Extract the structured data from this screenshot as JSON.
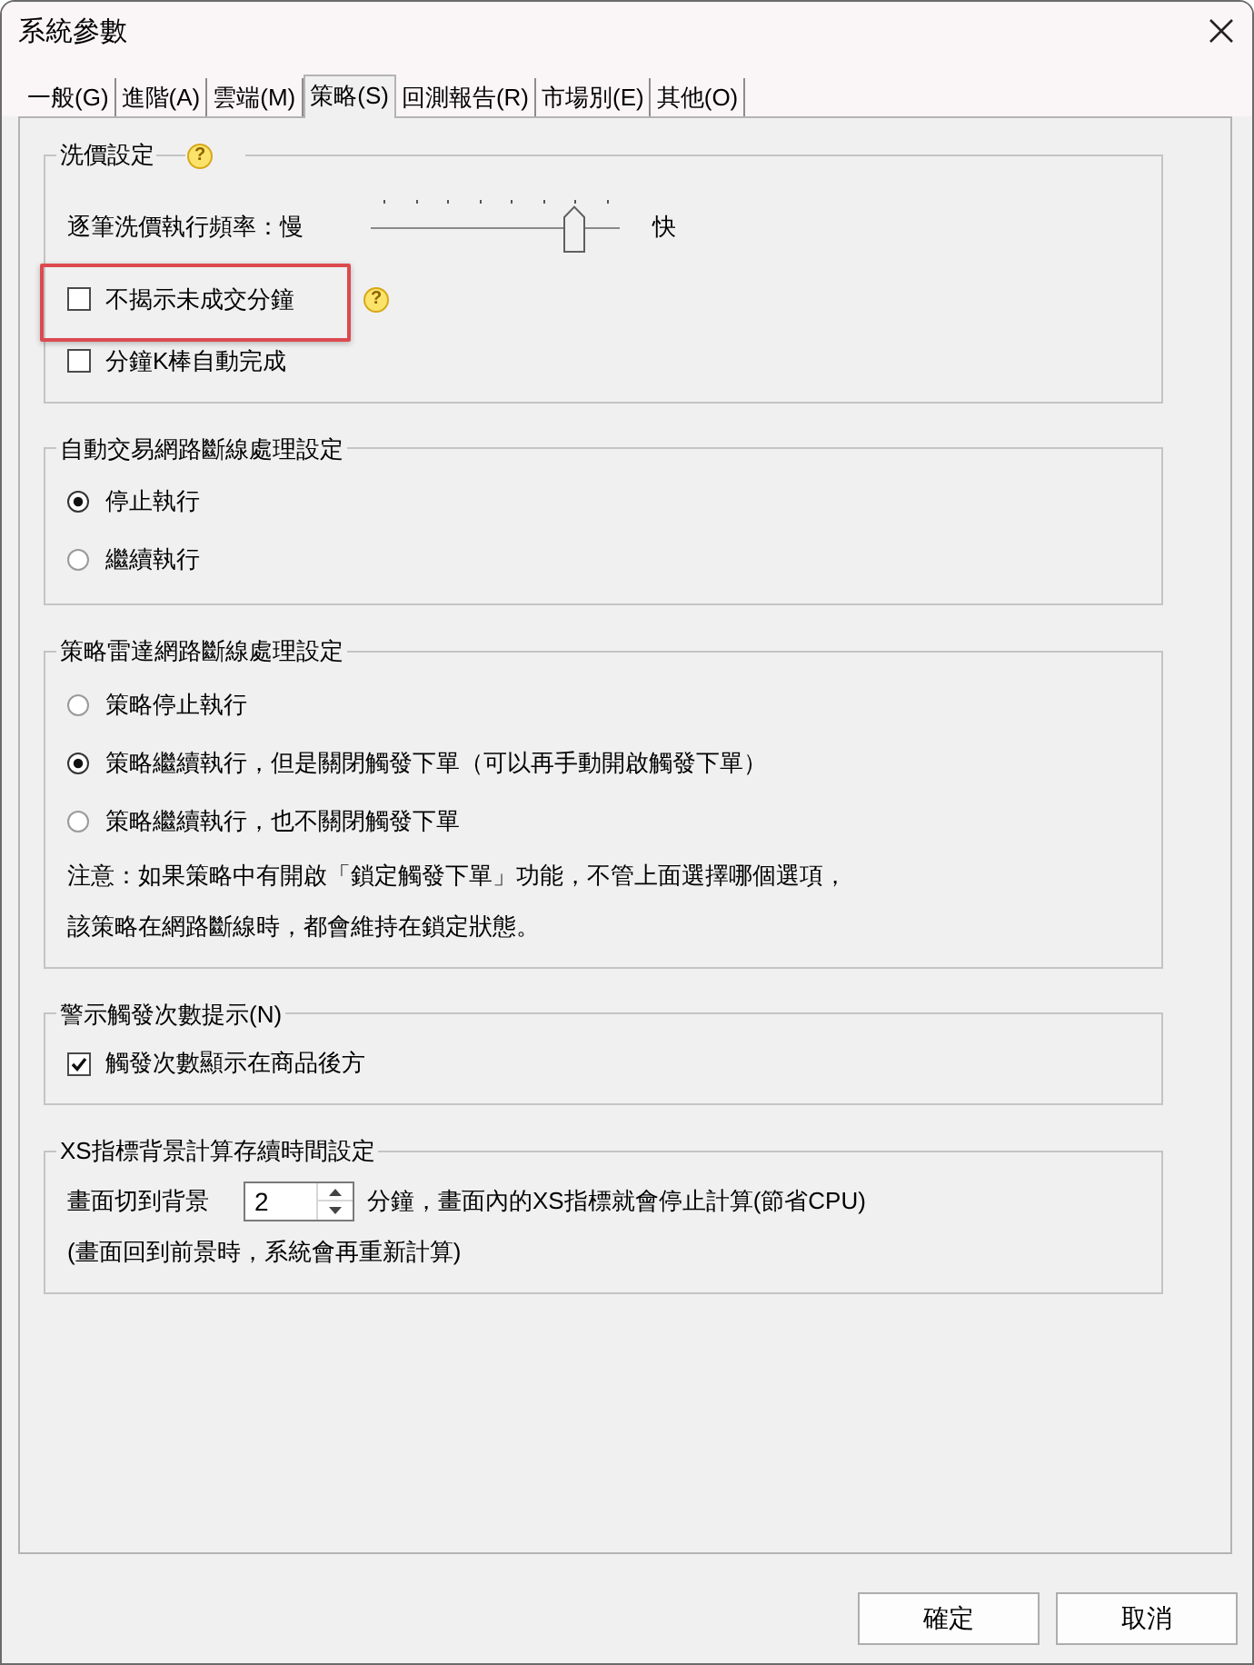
{
  "window": {
    "title": "系統參數"
  },
  "tabs": [
    {
      "label": "一般(G)",
      "selected": false
    },
    {
      "label": "進階(A)",
      "selected": false
    },
    {
      "label": "雲端(M)",
      "selected": false
    },
    {
      "label": "策略(S)",
      "selected": true
    },
    {
      "label": "回測報告(R)",
      "selected": false
    },
    {
      "label": "市場別(E)",
      "selected": false
    },
    {
      "label": "其他(O)",
      "selected": false
    }
  ],
  "groups": [
    {
      "title": "洗價設定",
      "help": "?",
      "items": [
        {
          "kind": "slider",
          "label": "逐筆洗價執行頻率：慢",
          "end_label": "快",
          "level": 0.857
        },
        {
          "kind": "checkbox",
          "label": "不揭示未成交分鐘",
          "checked": false,
          "help": "?",
          "highlighted": true
        },
        {
          "kind": "checkbox",
          "label": "分鐘K棒自動完成",
          "checked": false,
          "highlighted": false
        }
      ]
    },
    {
      "title": "自動交易網路斷線處理設定",
      "items": [
        {
          "kind": "radio",
          "label": "停止執行",
          "selected": true
        },
        {
          "kind": "radio",
          "label": "繼續執行",
          "selected": false
        }
      ]
    },
    {
      "title": "策略雷達網路斷線處理設定",
      "items": [
        {
          "kind": "radio",
          "label": "策略停止執行",
          "selected": false
        },
        {
          "kind": "radio",
          "label": "策略繼續執行，但是關閉觸發下單（可以再手動開啟觸發下單）",
          "selected": true
        },
        {
          "kind": "radio",
          "label": "策略繼續執行，也不關閉觸發下單",
          "selected": false
        },
        {
          "kind": "note",
          "text": "注意：如果策略中有開啟「鎖定觸發下單」功能，不管上面選擇哪個選項，"
        },
        {
          "kind": "note",
          "text": "該策略在網路斷線時，都會維持在鎖定狀態。"
        }
      ]
    },
    {
      "title": "警示觸發次數提示(N)",
      "items": [
        {
          "kind": "checkbox",
          "label": "觸發次數顯示在商品後方",
          "checked": true,
          "highlighted": false
        }
      ]
    },
    {
      "title": "XS指標背景計算存續時間設定",
      "items": [
        {
          "kind": "spin",
          "label": "畫面切到背景",
          "value": "2",
          "suffix": "分鐘，畫面內的XS指標就會停止計算(節省CPU)"
        },
        {
          "kind": "note",
          "text": "(畫面回到前景時，系統會再重新計算)"
        }
      ]
    }
  ],
  "buttons": [
    "確定",
    "取消"
  ]
}
